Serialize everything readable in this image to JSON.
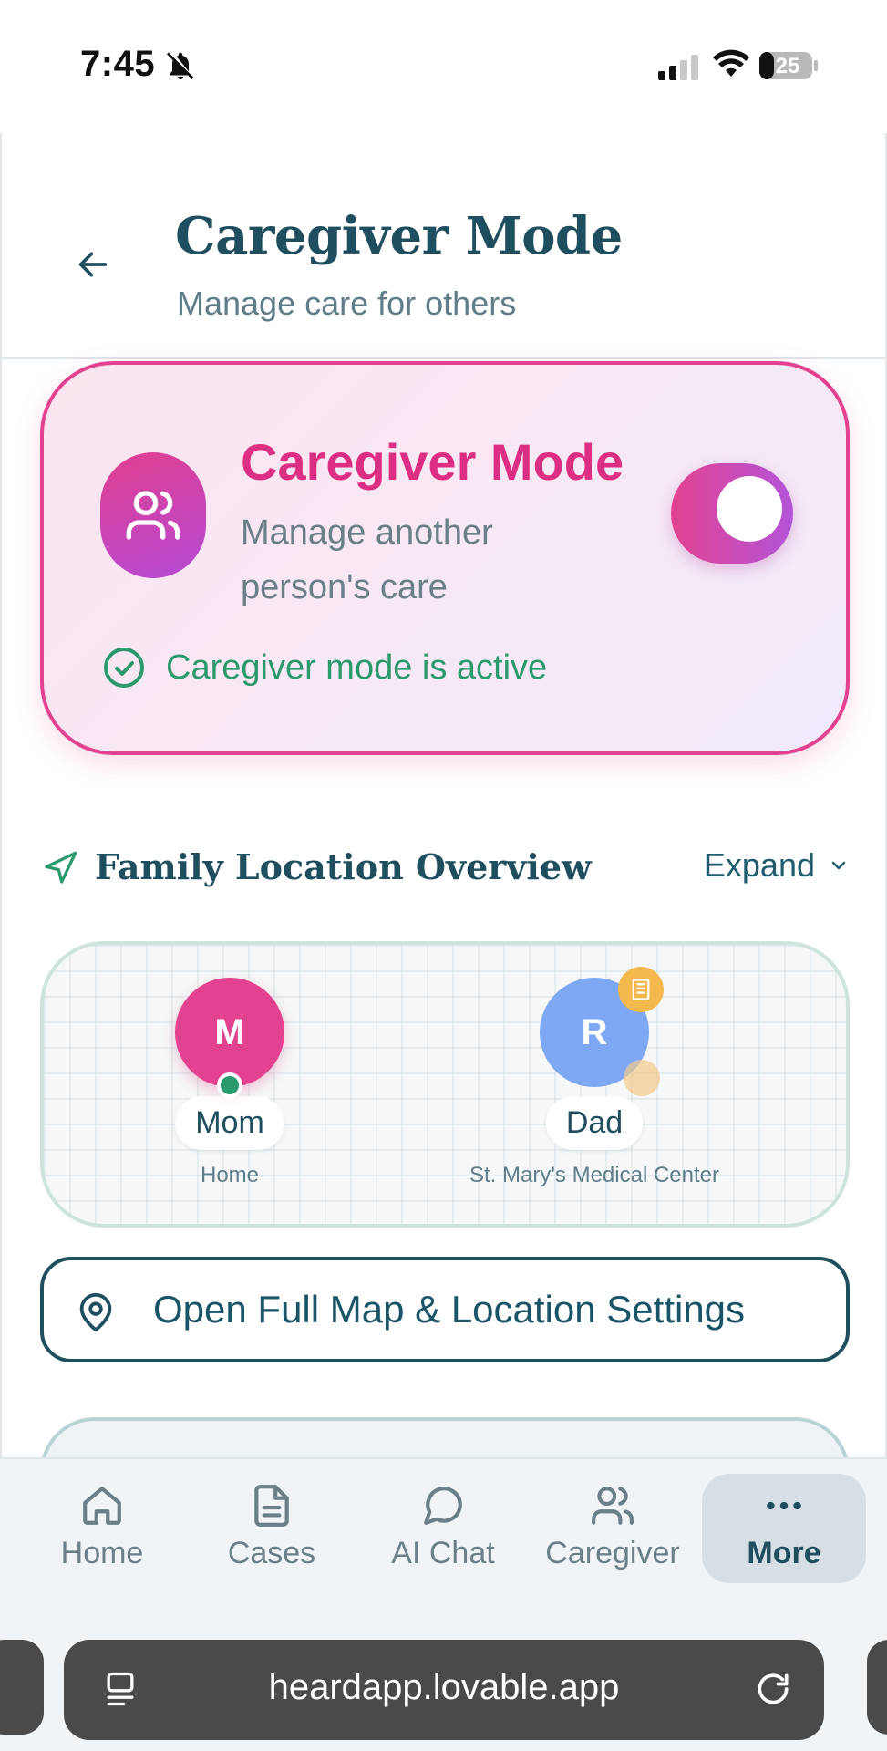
{
  "status_bar": {
    "time": "7:45",
    "battery": "25",
    "icons": [
      "bell-off-icon",
      "signal-icon",
      "wifi-icon",
      "battery-icon"
    ]
  },
  "header": {
    "title": "Caregiver Mode",
    "subtitle": "Manage care for others",
    "back_icon": "arrow-left-icon"
  },
  "caregiver_card": {
    "title": "Caregiver Mode",
    "description": "Manage another person's care",
    "toggle_on": true,
    "status_text": "Caregiver mode is active",
    "icon": "users-icon",
    "accent": "#e2428f",
    "accent2": "#b354d8",
    "status_color": "#2a9a6c"
  },
  "family_location": {
    "title": "Family Location Overview",
    "expand_label": "Expand",
    "people": [
      {
        "initial": "M",
        "name": "Mom",
        "place": "Home",
        "color": "#e2428f",
        "online": true
      },
      {
        "initial": "R",
        "name": "Dad",
        "place": "St. Mary's Medical Center",
        "color": "#7ea8f3",
        "badge": "hospital-icon"
      }
    ]
  },
  "open_map_button": {
    "label": "Open Full Map & Location Settings",
    "icon": "map-pin-icon"
  },
  "tab_bar": {
    "tabs": [
      {
        "label": "Home",
        "icon": "home-icon",
        "active": false
      },
      {
        "label": "Cases",
        "icon": "document-icon",
        "active": false
      },
      {
        "label": "AI Chat",
        "icon": "chat-bubble-icon",
        "active": false
      },
      {
        "label": "Caregiver",
        "icon": "users-icon",
        "active": false
      },
      {
        "label": "More",
        "icon": "more-dots-icon",
        "active": true
      }
    ]
  },
  "browser": {
    "url": "heardapp.lovable.app"
  }
}
